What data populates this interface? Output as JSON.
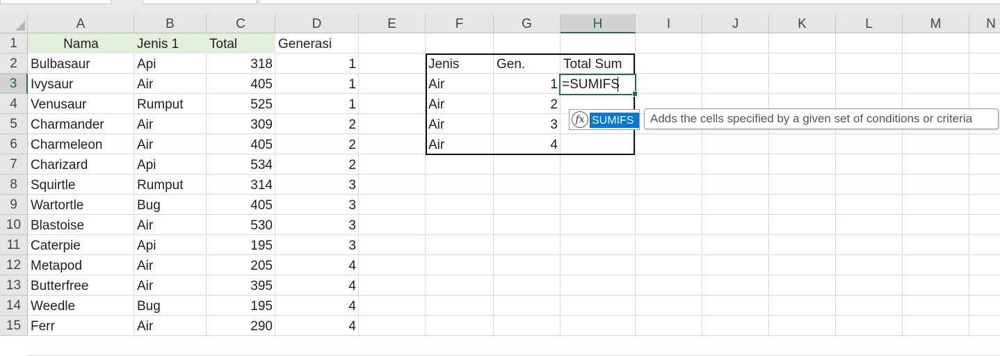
{
  "columns": [
    "A",
    "B",
    "C",
    "D",
    "E",
    "F",
    "G",
    "H",
    "I",
    "J",
    "K",
    "L",
    "M",
    "N"
  ],
  "rows": [
    "1",
    "2",
    "3",
    "4",
    "5",
    "6",
    "7",
    "8",
    "9",
    "10",
    "11",
    "12",
    "13",
    "14",
    "15"
  ],
  "selected_column": "H",
  "selected_row": "3",
  "main_table": {
    "headers": [
      "Nama",
      "Jenis 1",
      "Total",
      "Generasi"
    ],
    "data": [
      [
        "Bulbasaur",
        "Api",
        "318",
        "1"
      ],
      [
        "Ivysaur",
        "Air",
        "405",
        "1"
      ],
      [
        "Venusaur",
        "Rumput",
        "525",
        "1"
      ],
      [
        "Charmander",
        "Air",
        "309",
        "2"
      ],
      [
        "Charmeleon",
        "Air",
        "405",
        "2"
      ],
      [
        "Charizard",
        "Api",
        "534",
        "2"
      ],
      [
        "Squirtle",
        "Rumput",
        "314",
        "3"
      ],
      [
        "Wartortle",
        "Bug",
        "405",
        "3"
      ],
      [
        "Blastoise",
        "Air",
        "530",
        "3"
      ],
      [
        "Caterpie",
        "Api",
        "195",
        "3"
      ],
      [
        "Metapod",
        "Air",
        "205",
        "4"
      ],
      [
        "Butterfree",
        "Air",
        "395",
        "4"
      ],
      [
        "Weedle",
        "Bug",
        "195",
        "4"
      ],
      [
        "Ferr",
        "Air",
        "290",
        "4"
      ]
    ]
  },
  "summary_table": {
    "headers": [
      "Jenis",
      "Gen.",
      "Total Sum"
    ],
    "data": [
      [
        "Air",
        "1"
      ],
      [
        "Air",
        "2"
      ],
      [
        "Air",
        "3"
      ],
      [
        "Air",
        "4"
      ]
    ]
  },
  "editing": {
    "formula": "=SUMIFS"
  },
  "autocomplete": {
    "icon": "function-icon",
    "icon_glyph": "fx",
    "item": "SUMIFS",
    "tooltip": "Adds the cells specified by a given set of conditions or criteria"
  },
  "colors": {
    "accent": "#217346",
    "header_fill": "#e2efda",
    "autocomplete_highlight": "#0078d7"
  }
}
